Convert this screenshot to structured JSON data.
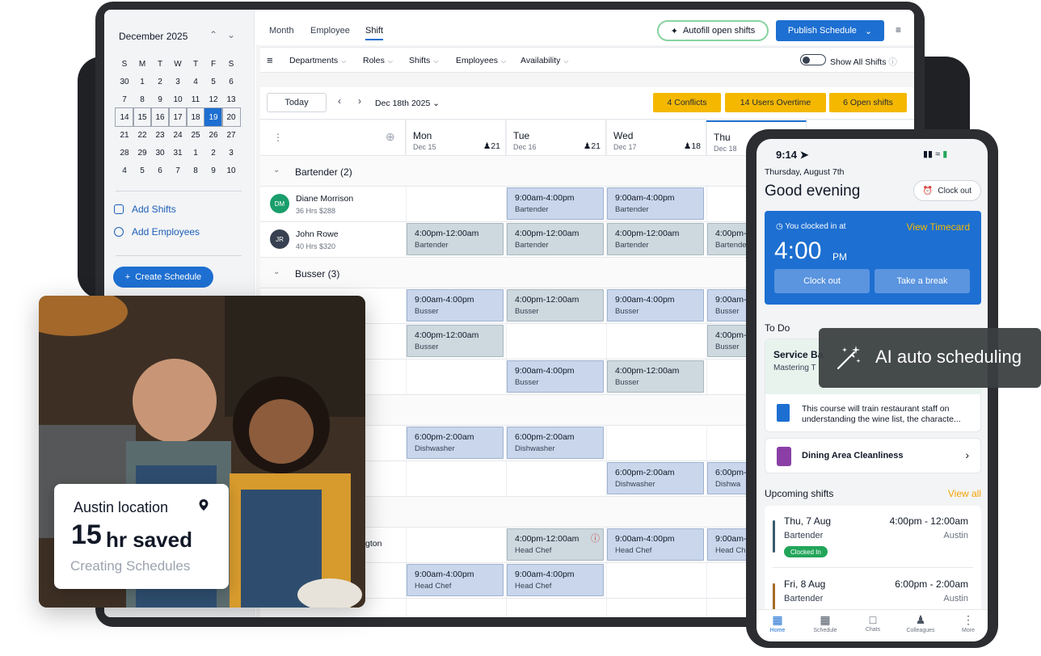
{
  "sidebar": {
    "month_label": "December 2025",
    "weekdays": [
      "S",
      "M",
      "T",
      "W",
      "T",
      "F",
      "S"
    ],
    "days": [
      [
        "30",
        "1",
        "2",
        "3",
        "4",
        "5",
        "6"
      ],
      [
        "7",
        "8",
        "9",
        "10",
        "11",
        "12",
        "13"
      ],
      [
        "14",
        "15",
        "16",
        "17",
        "18",
        "19",
        "20"
      ],
      [
        "21",
        "22",
        "23",
        "24",
        "25",
        "26",
        "27"
      ],
      [
        "28",
        "29",
        "30",
        "31",
        "1",
        "2",
        "3"
      ],
      [
        "4",
        "5",
        "6",
        "7",
        "8",
        "9",
        "10"
      ]
    ],
    "selected_day": "19",
    "add_shifts": "Add Shifts",
    "add_employees": "Add Employees",
    "create_schedule": "Create Schedule"
  },
  "topbar": {
    "tabs": [
      "Month",
      "Employee",
      "Shift"
    ],
    "active_tab": "Shift",
    "autofill": "Autofill open shifts",
    "publish": "Publish Schedule"
  },
  "filters": {
    "items": [
      "Departments",
      "Roles",
      "Shifts",
      "Employees",
      "Availability"
    ],
    "show_all": "Show All Shifts"
  },
  "toolbar": {
    "today": "Today",
    "date": "Dec 18th 2025",
    "conflicts": "4 Conflicts",
    "overtime": "14 Users Overtime",
    "open_shifts": "6 Open shifts"
  },
  "days": [
    {
      "name": "Mon",
      "date": "Dec 15",
      "count": "21"
    },
    {
      "name": "Tue",
      "date": "Dec 16",
      "count": "21"
    },
    {
      "name": "Wed",
      "date": "Dec 17",
      "count": "18"
    },
    {
      "name": "Thu",
      "date": "Dec 18",
      "count": ""
    }
  ],
  "groups": [
    {
      "label": "Bartender (2)"
    },
    {
      "label": "Busser (3)"
    }
  ],
  "employees": [
    {
      "initials": "DM",
      "name": "Diane Morrison",
      "meta": "36 Hrs   $288",
      "color": "#1a9e6b"
    },
    {
      "initials": "JR",
      "name": "John Rowe",
      "meta": "40 Hrs   $320",
      "color": "#374151"
    }
  ],
  "partial_name": "gton",
  "shifts": [
    {
      "time": "9:00am-4:00pm",
      "role": "Bartender"
    },
    {
      "time": "4:00pm-12:00am",
      "role": "Bartender"
    },
    {
      "time": "9:00am-4:00pm",
      "role": "Busser"
    },
    {
      "time": "4:00pm-12:00am",
      "role": "Busser"
    },
    {
      "time": "6:00pm-2:00am",
      "role": "Dishwasher"
    },
    {
      "time": "4:00pm-12:00am",
      "role": "Head Chef"
    },
    {
      "time": "9:00am-4:00pm",
      "role": "Head Chef"
    },
    {
      "time": "9:00am-",
      "role": "Busser"
    },
    {
      "time": "4:00pm-",
      "role": "Busser"
    },
    {
      "time": "6:00pm-",
      "role": "Dishwa"
    },
    {
      "time": "9:00am-",
      "role": "Head Ch"
    },
    {
      "time": "4:00pm-",
      "role": "Bartende"
    }
  ],
  "photo_card": {
    "location": "Austin location",
    "number": "15",
    "saved_text": "hr saved",
    "subtitle": "Creating Schedules"
  },
  "phone": {
    "time": "9:14",
    "date": "Thursday, August 7th",
    "greeting": "Good evening",
    "clock_out_pill": "Clock out",
    "clocked_in_label": "You clocked in at",
    "view_timecard": "View Timecard",
    "clock_time": "4:00",
    "clock_ampm": "PM",
    "clock_out_btn": "Clock out",
    "break_btn": "Take a break",
    "todo": "To Do",
    "service_title": "Service Ba",
    "service_sub": "Mastering T",
    "service_desc": "This course will train restaurant staff on understanding the wine list, the characte...",
    "dining": "Dining Area Cleanliness",
    "upcoming": "Upcoming shifts",
    "view_all": "View all",
    "up1": {
      "day": "Thu, 7 Aug",
      "role": "Bartender",
      "time": "4:00pm - 12:00am",
      "loc": "Austin",
      "badge": "Clocked In"
    },
    "up2": {
      "day": "Fri, 8 Aug",
      "role": "Bartender",
      "time": "6:00pm - 2:00am",
      "loc": "Austin"
    },
    "nav": [
      "Home",
      "Schedule",
      "Chats",
      "Colleagues",
      "More"
    ]
  },
  "ai_pill": "AI auto scheduling",
  "colors": {
    "accent": "#1d6fd1",
    "badge": "#f5b800",
    "shift_blue": "#c9d6ec",
    "shift_gray": "#cdd8df"
  }
}
